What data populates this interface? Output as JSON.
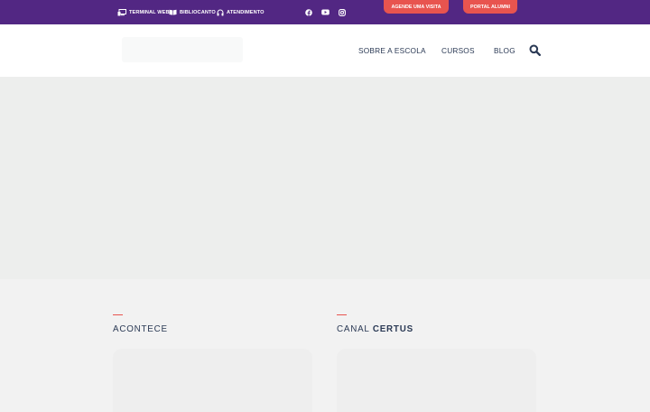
{
  "topbar": {
    "links": [
      {
        "label": "TERMINAL WEB",
        "icon": "monitor-icon"
      },
      {
        "label": "BIBLIOCANTO",
        "icon": "book-icon"
      },
      {
        "label": "ATENDIMENTO",
        "icon": "headset-icon"
      }
    ],
    "social": [
      {
        "icon": "facebook-icon"
      },
      {
        "icon": "youtube-icon"
      },
      {
        "icon": "instagram-icon"
      }
    ],
    "buttons": {
      "visit": "AGENDE UMA VISITA",
      "alumni": "PORTAL ALUMNI"
    }
  },
  "nav": {
    "items": [
      "SOBRE A ESCOLA",
      "CURSOS",
      "BLOG"
    ],
    "search_icon": "search-icon"
  },
  "sections": {
    "acontece": {
      "title": "ACONTECE"
    },
    "canal": {
      "title_prefix": "CANAL ",
      "title_bold": "CERTUS"
    }
  },
  "colors": {
    "topbar": "#522783",
    "accent": "#e8544f",
    "nav_text": "#2b3a55",
    "hero_placeholder": "#edeeed",
    "page_bg": "#f2f2f2"
  }
}
